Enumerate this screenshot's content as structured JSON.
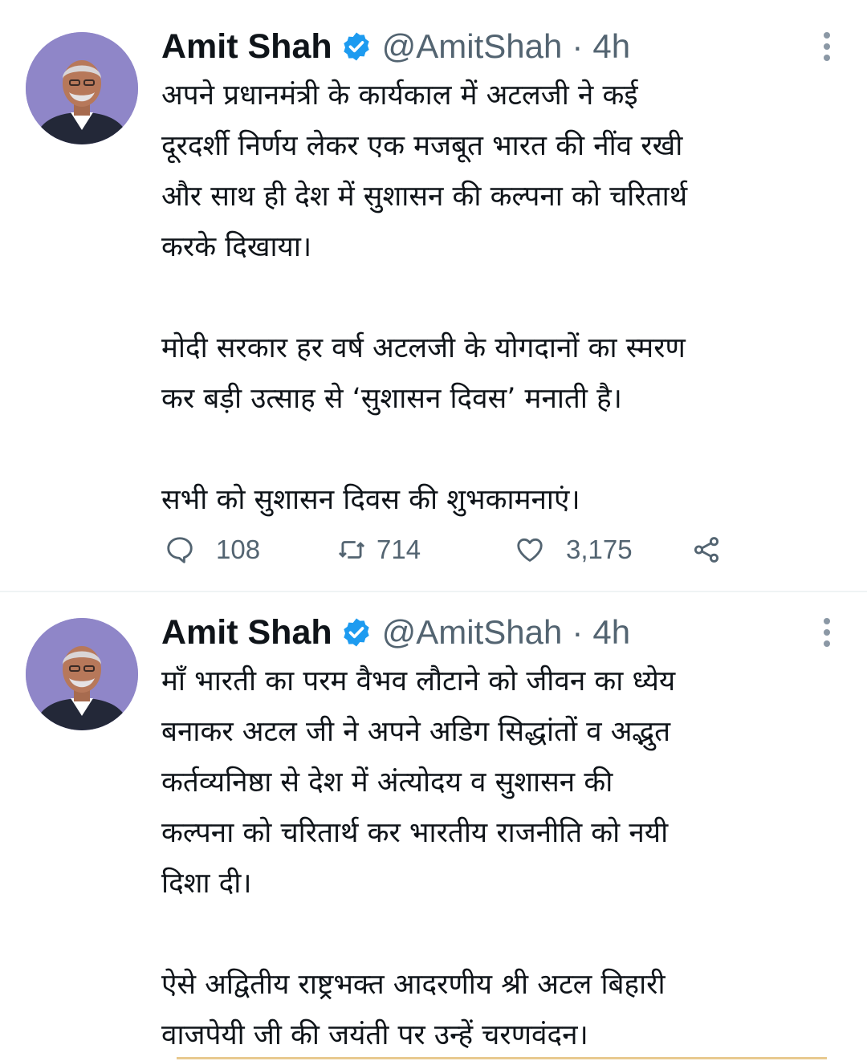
{
  "tweets": [
    {
      "author": "Amit Shah",
      "handle": "@AmitShah",
      "separator": "·",
      "time": "4h",
      "paragraphs": [
        "अपने प्रधानमंत्री के कार्यकाल में अटलजी ने कई\nदूरदर्शी निर्णय लेकर एक मजबूत भारत की नींव रखी\nऔर साथ ही देश में सुशासन की कल्पना को चरितार्थ\nकरके दिखाया।",
        "मोदी सरकार हर वर्ष अटलजी के योगदानों का स्मरण\nकर बड़ी उत्साह से ‘सुशासन दिवस’ मनाती है।",
        "सभी को सुशासन दिवस की शुभकामनाएं।"
      ],
      "replies": "108",
      "retweets": "714",
      "likes": "3,175"
    },
    {
      "author": "Amit Shah",
      "handle": "@AmitShah",
      "separator": "·",
      "time": "4h",
      "paragraphs": [
        "माँ भारती का परम वैभव लौटाने को जीवन का ध्येय\nबनाकर अटल जी ने अपने अडिग सिद्धांतों व अद्भुत\nकर्तव्यनिष्ठा से देश में अंत्योदय व सुशासन की\nकल्पना को चरितार्थ कर भारतीय राजनीति को नयी\nदिशा दी।",
        "ऐसे अद्वितीय राष्ट्रभक्त आदरणीय श्री अटल बिहारी\nवाजपेयी जी की जयंती पर उन्हें चरणवंदन।"
      ]
    }
  ],
  "icons": {
    "verified": "verified-badge-icon",
    "more": "more-vertical-icon",
    "reply": "reply-bubble-icon",
    "retweet": "retweet-icon",
    "like": "heart-icon",
    "share": "share-icon"
  },
  "colors": {
    "accent": "#1d9bf0",
    "secondary_text": "#536471",
    "divider": "#eff3f4",
    "avatar_bg": "#8f86c8"
  }
}
